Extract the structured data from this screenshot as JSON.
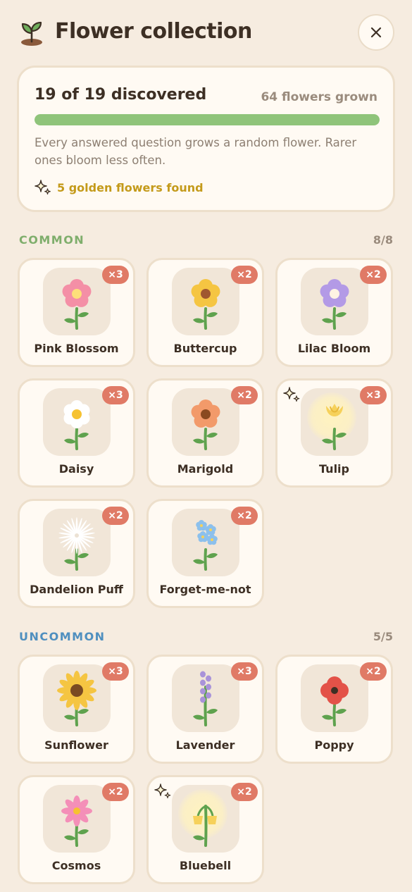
{
  "header": {
    "title": "Flower collection",
    "logo_icon": "sprout-icon",
    "close_icon": "close-icon"
  },
  "summary": {
    "discovered": "19 of 19 discovered",
    "grown": "64 flowers grown",
    "progress": 1.0,
    "description": "Every answered question grows a random flower. Rarer ones bloom less often.",
    "golden": "5 golden flowers found",
    "accent": "#8fc47a",
    "golden_color": "#c49a1a"
  },
  "sections": [
    {
      "label": "COMMON",
      "count": "8/8",
      "color": "#7fae6c",
      "flowers": [
        {
          "name": "Pink Blossom",
          "count": "×3",
          "golden": false,
          "icon": "pink-blossom-icon"
        },
        {
          "name": "Buttercup",
          "count": "×2",
          "golden": false,
          "icon": "buttercup-icon"
        },
        {
          "name": "Lilac Bloom",
          "count": "×2",
          "golden": false,
          "icon": "lilac-bloom-icon"
        },
        {
          "name": "Daisy",
          "count": "×3",
          "golden": false,
          "icon": "daisy-icon"
        },
        {
          "name": "Marigold",
          "count": "×2",
          "golden": false,
          "icon": "marigold-icon"
        },
        {
          "name": "Tulip",
          "count": "×3",
          "golden": true,
          "icon": "tulip-icon"
        },
        {
          "name": "Dandelion Puff",
          "count": "×2",
          "golden": false,
          "icon": "dandelion-puff-icon"
        },
        {
          "name": "Forget-me-not",
          "count": "×2",
          "golden": false,
          "icon": "forget-me-not-icon"
        }
      ]
    },
    {
      "label": "UNCOMMON",
      "count": "5/5",
      "color": "#4f8fbf",
      "flowers": [
        {
          "name": "Sunflower",
          "count": "×3",
          "golden": false,
          "icon": "sunflower-icon"
        },
        {
          "name": "Lavender",
          "count": "×3",
          "golden": false,
          "icon": "lavender-icon"
        },
        {
          "name": "Poppy",
          "count": "×2",
          "golden": false,
          "icon": "poppy-icon"
        },
        {
          "name": "Cosmos",
          "count": "×2",
          "golden": false,
          "icon": "cosmos-icon"
        },
        {
          "name": "Bluebell",
          "count": "×2",
          "golden": true,
          "icon": "bluebell-icon"
        }
      ]
    }
  ]
}
